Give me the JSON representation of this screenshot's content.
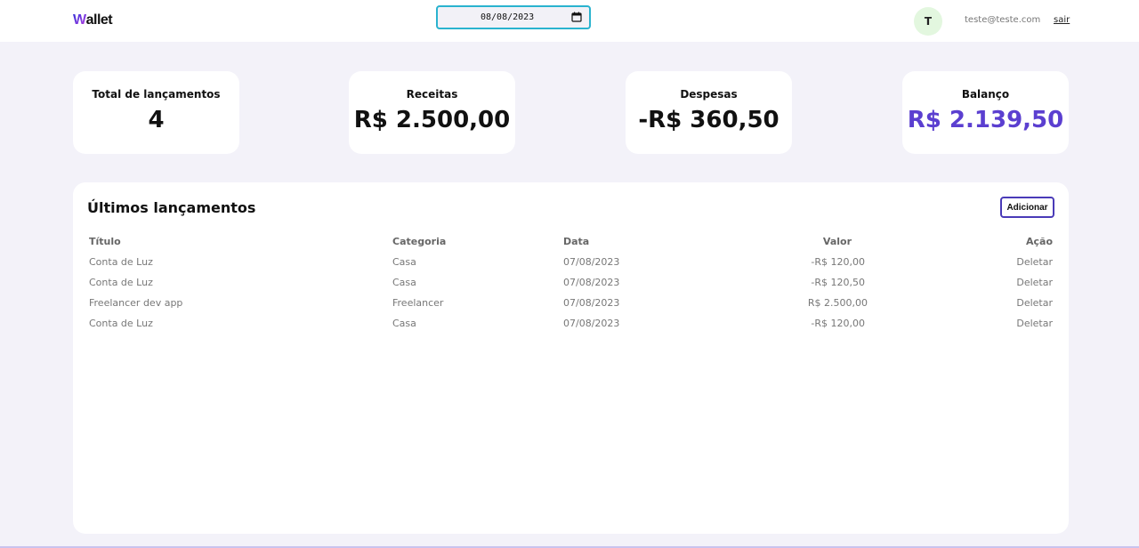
{
  "header": {
    "logo_first": "W",
    "logo_rest": "allet",
    "date_value": "08/08/2023",
    "avatar_initial": "T",
    "user_email": "teste@teste.com",
    "logout_label": "sair"
  },
  "summary": {
    "total": {
      "label": "Total de lançamentos",
      "value": "4"
    },
    "receitas": {
      "label": "Receitas",
      "value": "R$ 2.500,00"
    },
    "despesas": {
      "label": "Despesas",
      "value": "-R$ 360,50"
    },
    "balanco": {
      "label": "Balanço",
      "value": "R$ 2.139,50"
    }
  },
  "transactions": {
    "title": "Últimos lançamentos",
    "add_label": "Adicionar",
    "columns": {
      "titulo": "Título",
      "categoria": "Categoria",
      "data": "Data",
      "valor": "Valor",
      "acao": "Ação"
    },
    "rows": [
      {
        "titulo": "Conta de Luz",
        "categoria": "Casa",
        "data": "07/08/2023",
        "valor": "-R$ 120,00",
        "acao": "Deletar"
      },
      {
        "titulo": "Conta de Luz",
        "categoria": "Casa",
        "data": "07/08/2023",
        "valor": "-R$ 120,50",
        "acao": "Deletar"
      },
      {
        "titulo": "Freelancer dev app",
        "categoria": "Freelancer",
        "data": "07/08/2023",
        "valor": "R$ 2.500,00",
        "acao": "Deletar"
      },
      {
        "titulo": "Conta de Luz",
        "categoria": "Casa",
        "data": "07/08/2023",
        "valor": "-R$ 120,00",
        "acao": "Deletar"
      }
    ]
  },
  "colors": {
    "background": "#f3f2f9",
    "accent": "#5b3fd0",
    "date_border": "#2ab3cf",
    "avatar_bg": "#e3f7df"
  },
  "icons": {
    "date_picker": "calendar-icon"
  }
}
